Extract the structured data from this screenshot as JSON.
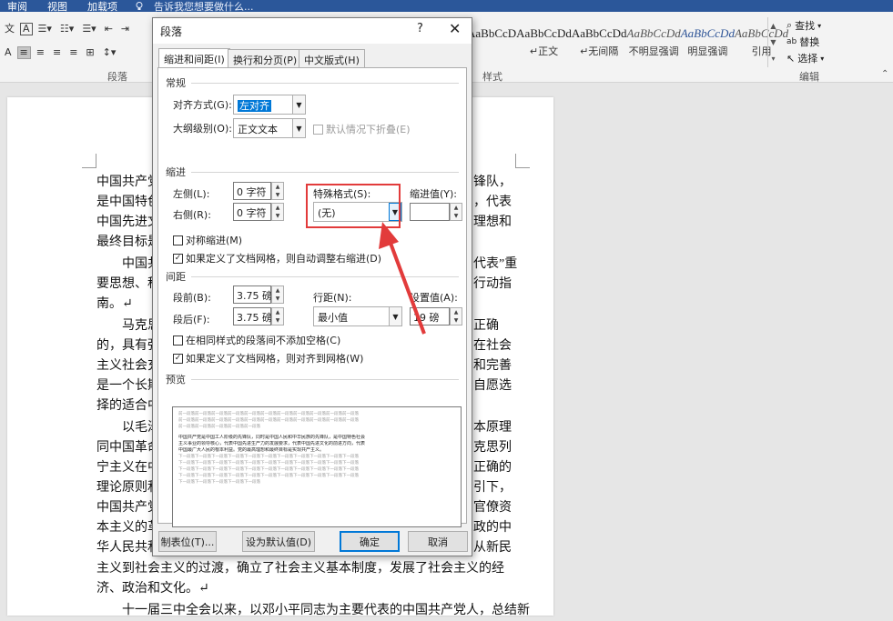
{
  "ribbon": {
    "tabs": [
      "审阅",
      "视图",
      "加载项"
    ],
    "tell_me": "告诉我您想要做什么...",
    "paragraph_group": "段落",
    "styles_group": "样式",
    "editing_group": "编辑",
    "styles": [
      {
        "sample": "AaBbCcD",
        "name": ""
      },
      {
        "sample": "AaBbCcDd",
        "name": "↵正文"
      },
      {
        "sample": "AaBbCcDd",
        "name": "↵无间隔"
      },
      {
        "sample": "AaBbCcDd",
        "name": "不明显强调"
      },
      {
        "sample": "AaBbCcDd",
        "name": "明显强调"
      },
      {
        "sample": "AaBbCcDd",
        "name": "引用"
      }
    ],
    "editing": {
      "find": "查找",
      "replace": "替换",
      "select": "选择"
    }
  },
  "document": {
    "lines": [
      "中国共产党",
      "是中国特色",
      "中国先进文",
      "最终目标是",
      "中国共",
      "要思想、科",
      "南。↵",
      "马克思",
      "的，具有强",
      "主义社会充",
      "是一个长期",
      "择的适合中",
      "以毛泽",
      "同中国革命",
      "宁主义在中",
      "理论原则和",
      "中国共产党",
      "本主义的革",
      "华人民共和"
    ],
    "right_fragments": [
      "锋队，",
      "，代表",
      "理想和",
      "代表”重",
      "行动指",
      "正确",
      "在社会",
      "和完善",
      "自愿选",
      "本原理",
      "克思列",
      "正确的",
      "引下，",
      "官僚资",
      "政的中",
      "从新民"
    ],
    "full_lines": [
      "主义到社会主义的过渡，确立了社会主义基本制度，发展了社会主义的经",
      "济、政治和文化。↵",
      "十一届三中全会以来，以邓小平同志为主要代表的中国共产党人，总结新"
    ]
  },
  "dialog": {
    "title": "段落",
    "help": "?",
    "close": "✕",
    "tabs": [
      "缩进和间距(I)",
      "换行和分页(P)",
      "中文版式(H)"
    ],
    "general": {
      "section": "常规",
      "alignment_label": "对齐方式(G):",
      "alignment_value": "左对齐",
      "outline_label": "大纲级别(O):",
      "outline_value": "正文文本",
      "collapse_label": "默认情况下折叠(E)"
    },
    "indent": {
      "section": "缩进",
      "left_label": "左侧(L):",
      "left_value": "0 字符",
      "right_label": "右侧(R):",
      "right_value": "0 字符",
      "special_label": "特殊格式(S):",
      "special_value": "(无)",
      "by_label": "缩进值(Y):",
      "by_value": "",
      "mirror_label": "对称缩进(M)",
      "grid_label": "如果定义了文档网格，则自动调整右缩进(D)"
    },
    "spacing": {
      "section": "间距",
      "before_label": "段前(B):",
      "before_value": "3.75 磅",
      "after_label": "段后(F):",
      "after_value": "3.75 磅",
      "line_label": "行距(N):",
      "line_value": "最小值",
      "at_label": "设置值(A):",
      "at_value": "19 磅",
      "no_space_label": "在相同样式的段落间不添加空格(C)",
      "snap_label": "如果定义了文档网格，则对齐到网格(W)"
    },
    "preview": {
      "section": "预览",
      "prev_lines": [
        "前一段落前一段落前一段落前一段落前一段落前一段落前一段落前一段落前一段落前一段落前一段落",
        "前一段落前一段落前一段落前一段落前一段落前一段落前一段落前一段落前一段落前一段落前一段落",
        "前一段落前一段落前一段落前一段落前一段落"
      ],
      "sample_lines": [
        "中国共产党是中国工人阶级的先锋队，同时是中国人民和中华民族的先锋队，是中国特色社会",
        "主义事业的领导核心，代表中国先进生产力的发展要求，代表中国先进文化的前进方向，代表",
        "中国最广大人民的根本利益。党的最高理想和最终目标是实现共产主义。"
      ],
      "next_lines": [
        "下一段落下一段落下一段落下一段落下一段落下一段落下一段落下一段落下一段落下一段落下一段落",
        "下一段落下一段落下一段落下一段落下一段落下一段落下一段落下一段落下一段落下一段落下一段落",
        "下一段落下一段落下一段落下一段落下一段落下一段落下一段落下一段落下一段落下一段落下一段落",
        "下一段落下一段落下一段落下一段落下一段落下一段落下一段落下一段落下一段落下一段落下一段落",
        "下一段落下一段落下一段落下一段落下一段落"
      ]
    },
    "buttons": {
      "tabs": "制表位(T)...",
      "set_default": "设为默认值(D)",
      "ok": "确定",
      "cancel": "取消"
    }
  },
  "colors": {
    "ribbon_tab_bg": "#2b579a",
    "highlight_red": "#e23b3b",
    "selection_blue": "#0078d7"
  }
}
